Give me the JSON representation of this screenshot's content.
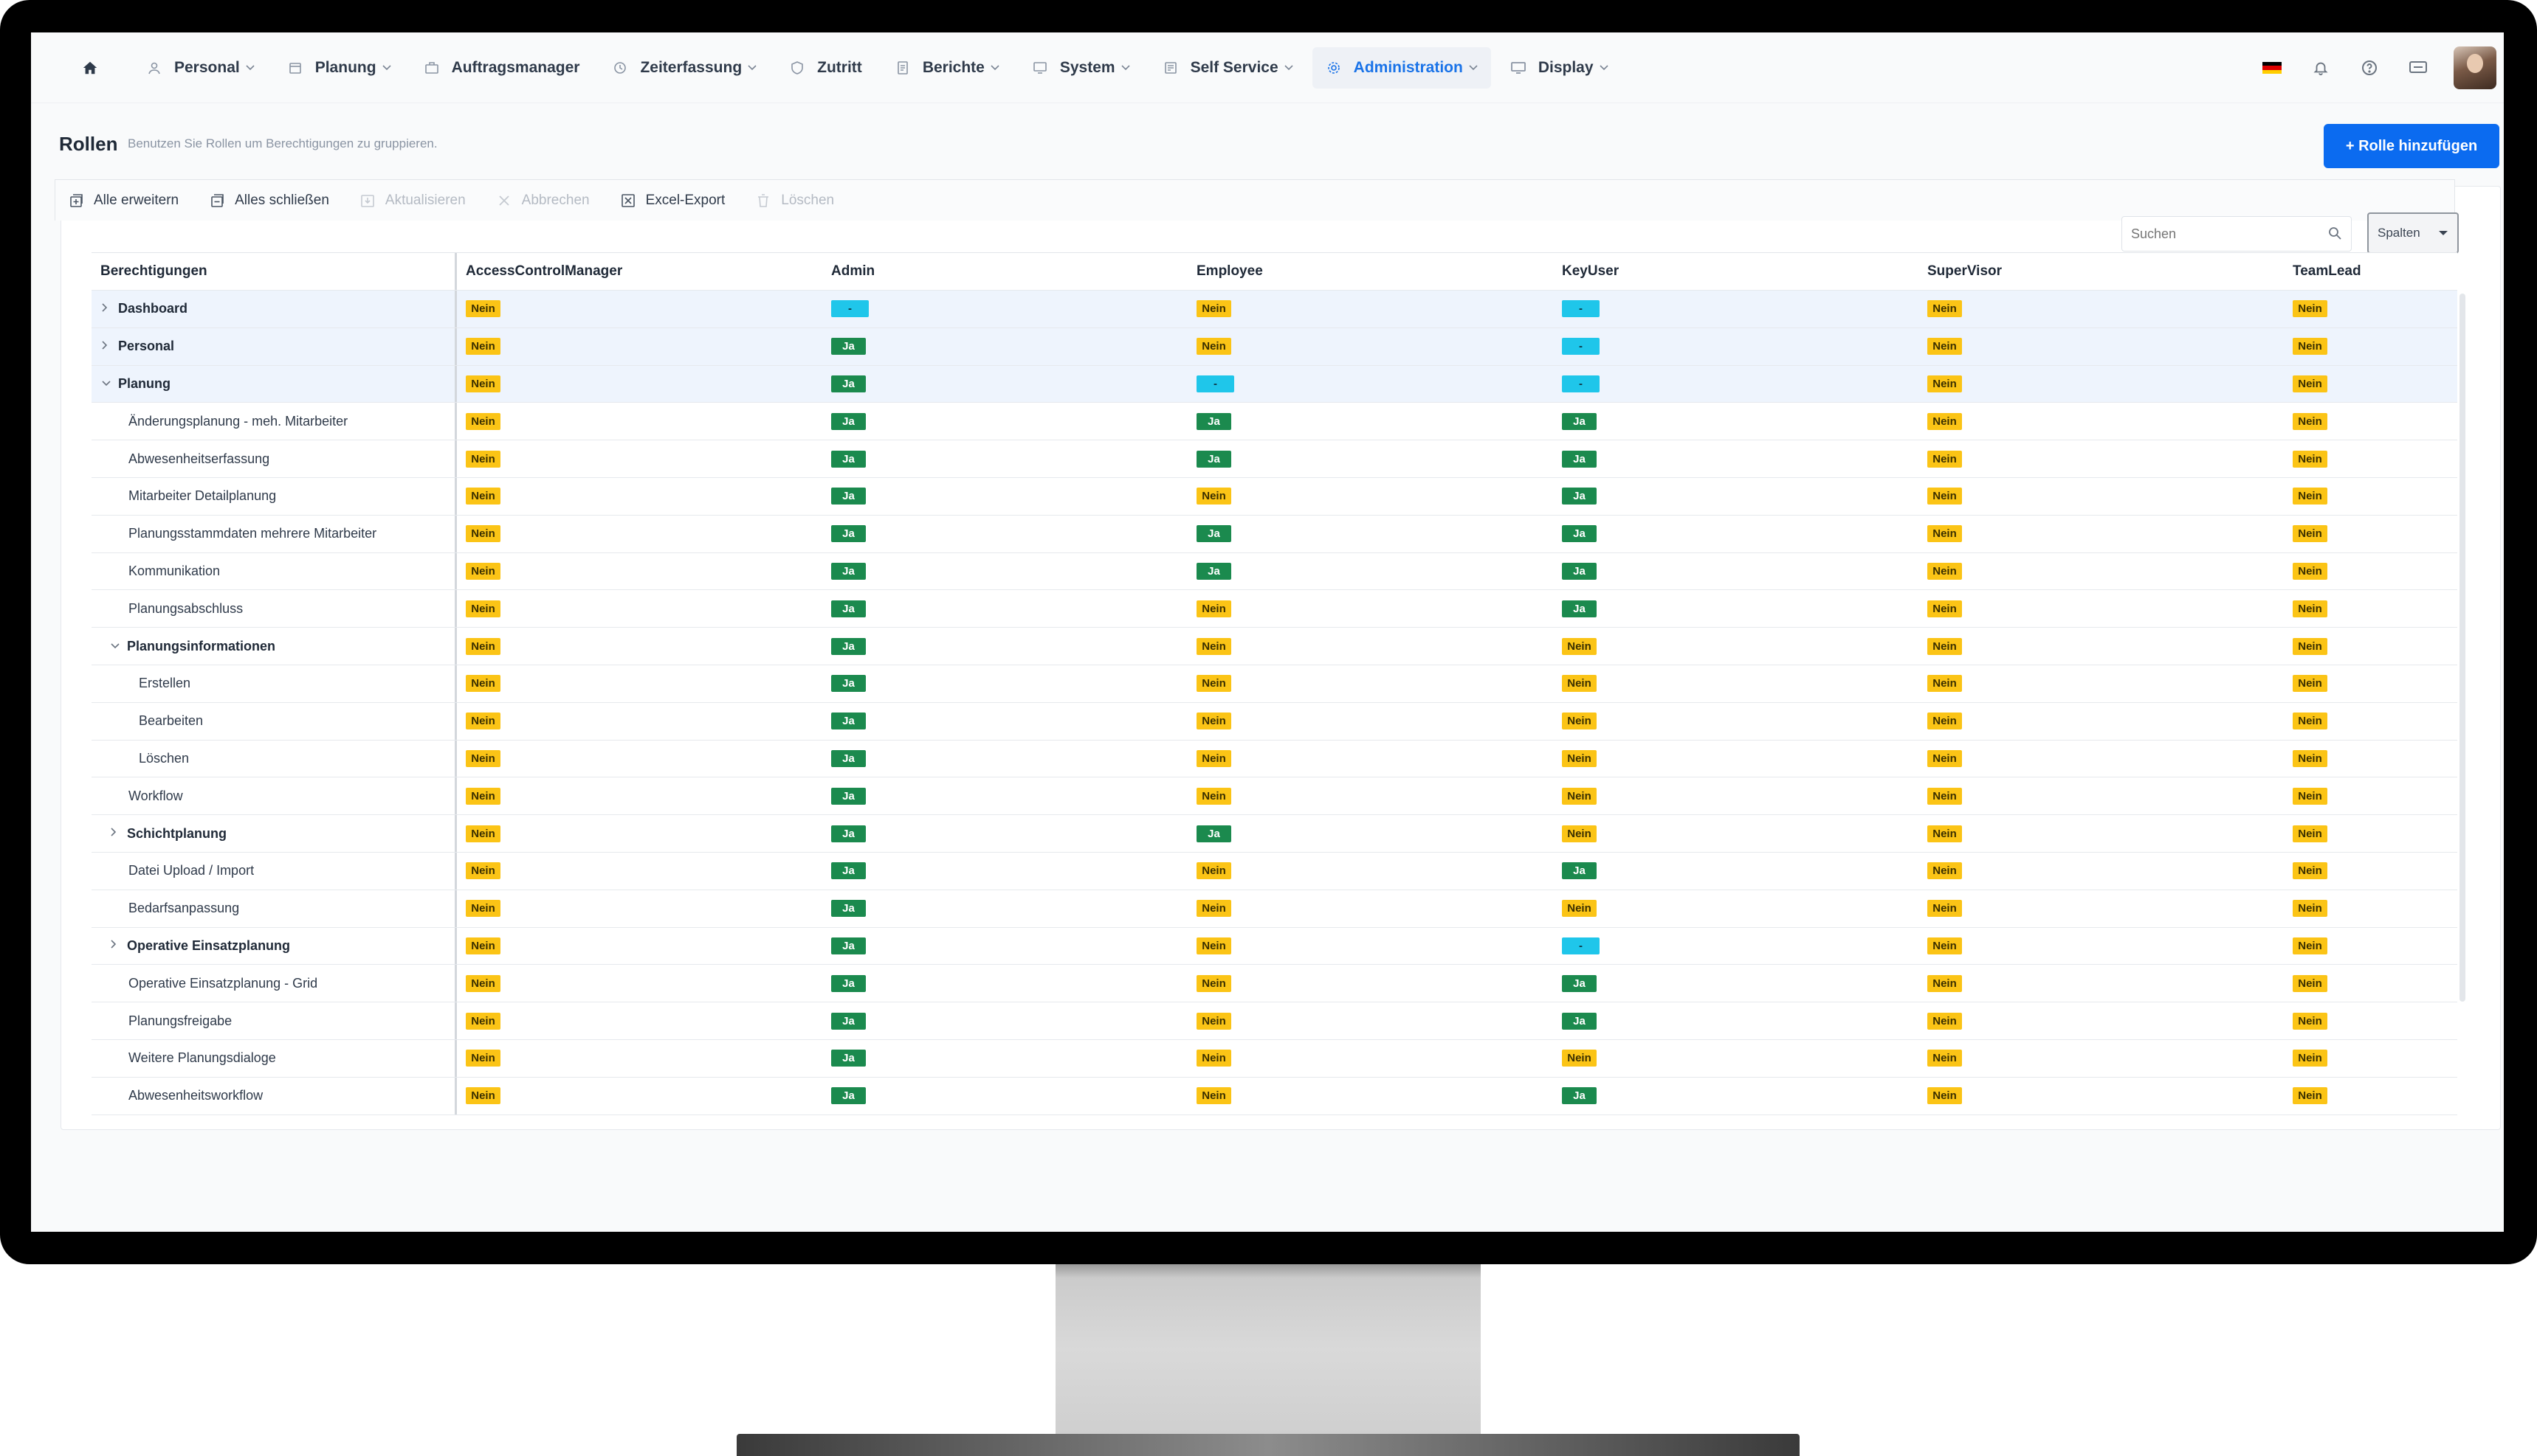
{
  "nav": {
    "items": [
      {
        "label": "Personal",
        "icon": "person-icon",
        "dropdown": true
      },
      {
        "label": "Planung",
        "icon": "calendar-icon",
        "dropdown": true
      },
      {
        "label": "Auftragsmanager",
        "icon": "briefcase-icon",
        "dropdown": false
      },
      {
        "label": "Zeiterfassung",
        "icon": "clock-icon",
        "dropdown": true
      },
      {
        "label": "Zutritt",
        "icon": "shield-icon",
        "dropdown": false
      },
      {
        "label": "Berichte",
        "icon": "report-icon",
        "dropdown": true
      },
      {
        "label": "System",
        "icon": "system-icon",
        "dropdown": true
      },
      {
        "label": "Self Service",
        "icon": "self-service-icon",
        "dropdown": true
      },
      {
        "label": "Administration",
        "icon": "gear-icon",
        "dropdown": true,
        "active": true
      },
      {
        "label": "Display",
        "icon": "monitor-icon",
        "dropdown": true
      }
    ]
  },
  "page": {
    "title": "Rollen",
    "subtitle": "Benutzen Sie Rollen um Berechtigungen zu gruppieren.",
    "add_button": "+ Rolle hinzufügen"
  },
  "toolbar": {
    "expand_all": "Alle erweitern",
    "collapse_all": "Alles schließen",
    "refresh": "Aktualisieren",
    "cancel": "Abbrechen",
    "excel_export": "Excel-Export",
    "delete": "Löschen",
    "search_placeholder": "Suchen",
    "columns": "Spalten"
  },
  "table": {
    "headers": [
      "Berechtigungen",
      "AccessControlManager",
      "Admin",
      "Employee",
      "KeyUser",
      "SuperVisor",
      "TeamLead"
    ],
    "rows": [
      {
        "name": "Dashboard",
        "level": 0,
        "caret": "right",
        "group": true,
        "bold": true,
        "values": [
          "Nein",
          "-",
          "Nein",
          "-",
          "Nein",
          "Nein"
        ]
      },
      {
        "name": "Personal",
        "level": 0,
        "caret": "right",
        "group": true,
        "bold": true,
        "values": [
          "Nein",
          "Ja",
          "Nein",
          "-",
          "Nein",
          "Nein"
        ]
      },
      {
        "name": "Planung",
        "level": 0,
        "caret": "down",
        "group": true,
        "bold": true,
        "values": [
          "Nein",
          "Ja",
          "-",
          "-",
          "Nein",
          "Nein"
        ]
      },
      {
        "name": "Änderungsplanung - meh. Mitarbeiter",
        "level": 1,
        "values": [
          "Nein",
          "Ja",
          "Ja",
          "Ja",
          "Nein",
          "Nein"
        ]
      },
      {
        "name": "Abwesenheitserfassung",
        "level": 1,
        "values": [
          "Nein",
          "Ja",
          "Ja",
          "Ja",
          "Nein",
          "Nein"
        ]
      },
      {
        "name": "Mitarbeiter Detailplanung",
        "level": 1,
        "values": [
          "Nein",
          "Ja",
          "Nein",
          "Ja",
          "Nein",
          "Nein"
        ]
      },
      {
        "name": "Planungsstammdaten mehrere Mitarbeiter",
        "level": 1,
        "values": [
          "Nein",
          "Ja",
          "Ja",
          "Ja",
          "Nein",
          "Nein"
        ]
      },
      {
        "name": "Kommunikation",
        "level": 1,
        "values": [
          "Nein",
          "Ja",
          "Ja",
          "Ja",
          "Nein",
          "Nein"
        ]
      },
      {
        "name": "Planungsabschluss",
        "level": 1,
        "values": [
          "Nein",
          "Ja",
          "Nein",
          "Ja",
          "Nein",
          "Nein"
        ]
      },
      {
        "name": "Planungsinformationen",
        "level": 1,
        "caret": "down",
        "bold": true,
        "values": [
          "Nein",
          "Ja",
          "Nein",
          "Nein",
          "Nein",
          "Nein"
        ]
      },
      {
        "name": "Erstellen",
        "level": 2,
        "values": [
          "Nein",
          "Ja",
          "Nein",
          "Nein",
          "Nein",
          "Nein"
        ]
      },
      {
        "name": "Bearbeiten",
        "level": 2,
        "values": [
          "Nein",
          "Ja",
          "Nein",
          "Nein",
          "Nein",
          "Nein"
        ]
      },
      {
        "name": "Löschen",
        "level": 2,
        "values": [
          "Nein",
          "Ja",
          "Nein",
          "Nein",
          "Nein",
          "Nein"
        ]
      },
      {
        "name": "Workflow",
        "level": 1,
        "values": [
          "Nein",
          "Ja",
          "Nein",
          "Nein",
          "Nein",
          "Nein"
        ]
      },
      {
        "name": "Schichtplanung",
        "level": 1,
        "caret": "right",
        "bold": true,
        "values": [
          "Nein",
          "Ja",
          "Ja",
          "Nein",
          "Nein",
          "Nein"
        ]
      },
      {
        "name": "Datei Upload / Import",
        "level": 1,
        "values": [
          "Nein",
          "Ja",
          "Nein",
          "Ja",
          "Nein",
          "Nein"
        ]
      },
      {
        "name": "Bedarfsanpassung",
        "level": 1,
        "values": [
          "Nein",
          "Ja",
          "Nein",
          "Nein",
          "Nein",
          "Nein"
        ]
      },
      {
        "name": "Operative Einsatzplanung",
        "level": 1,
        "caret": "right",
        "bold": true,
        "values": [
          "Nein",
          "Ja",
          "Nein",
          "-",
          "Nein",
          "Nein"
        ]
      },
      {
        "name": "Operative Einsatzplanung - Grid",
        "level": 1,
        "values": [
          "Nein",
          "Ja",
          "Nein",
          "Ja",
          "Nein",
          "Nein"
        ]
      },
      {
        "name": "Planungsfreigabe",
        "level": 1,
        "values": [
          "Nein",
          "Ja",
          "Nein",
          "Ja",
          "Nein",
          "Nein"
        ]
      },
      {
        "name": "Weitere Planungsdialoge",
        "level": 1,
        "values": [
          "Nein",
          "Ja",
          "Nein",
          "Nein",
          "Nein",
          "Nein"
        ]
      },
      {
        "name": "Abwesenheitsworkflow",
        "level": 1,
        "values": [
          "Nein",
          "Ja",
          "Nein",
          "Ja",
          "Nein",
          "Nein"
        ]
      }
    ]
  },
  "colors": {
    "nein": "#fbc416",
    "ja": "#1b8a4e",
    "dash": "#1fc6ea",
    "accent": "#0b6bf0",
    "group_row": "#eef4fd"
  }
}
